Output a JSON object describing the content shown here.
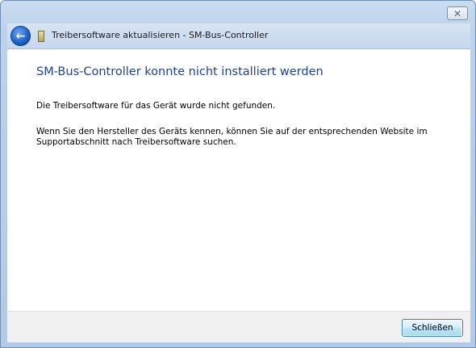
{
  "window": {
    "close_glyph": "✕"
  },
  "nav": {
    "back_glyph": "←",
    "title": "Treibersoftware aktualisieren - SM-Bus-Controller"
  },
  "content": {
    "heading": "SM-Bus-Controller konnte nicht installiert werden",
    "paragraph1": "Die Treibersoftware für das Gerät wurde nicht gefunden.",
    "paragraph2": "Wenn Sie den Hersteller des Geräts kennen, können Sie auf der entsprechenden Website im Supportabschnitt nach Treibersoftware suchen."
  },
  "footer": {
    "close_button_label": "Schließen"
  },
  "colors": {
    "heading": "#1c3fa3",
    "nav_bar": "#c6d7ed"
  },
  "icons": {
    "back": "back-arrow-icon",
    "device": "device-icon",
    "window_close": "close-icon"
  }
}
